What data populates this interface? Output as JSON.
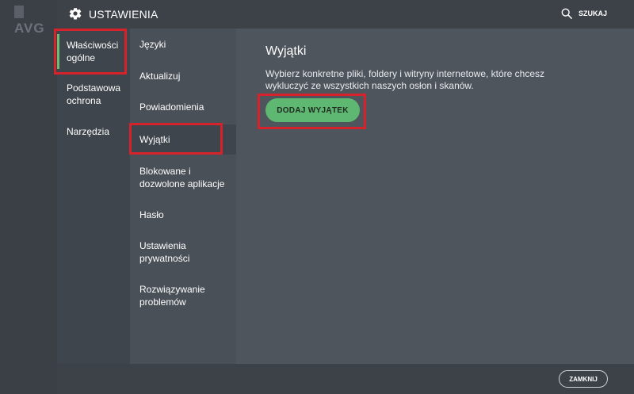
{
  "background_app": {
    "logo_text": "AVG"
  },
  "titlebar": {
    "title": "USTAWIENIA",
    "icon": "gear-icon",
    "search_label": "SZUKAJ",
    "search_icon": "search-icon"
  },
  "nav_primary": {
    "items": [
      {
        "label": "Właściwości ogólne",
        "active": true
      },
      {
        "label": "Podstawowa ochrona",
        "active": false
      },
      {
        "label": "Narzędzia",
        "active": false
      }
    ]
  },
  "nav_secondary": {
    "items": [
      {
        "label": "Języki",
        "active": false
      },
      {
        "label": "Aktualizuj",
        "active": false
      },
      {
        "label": "Powiadomienia",
        "active": false
      },
      {
        "label": "Wyjątki",
        "active": true
      },
      {
        "label": "Blokowane i dozwolone aplikacje",
        "active": false
      },
      {
        "label": "Hasło",
        "active": false
      },
      {
        "label": "Ustawienia prywatności",
        "active": false
      },
      {
        "label": "Rozwiązywanie problemów",
        "active": false
      }
    ]
  },
  "main": {
    "title": "Wyjątki",
    "description": "Wybierz konkretne pliki, foldery i witryny internetowe, które chcesz wykluczyć ze wszystkich naszych osłon i skanów.",
    "add_button_label": "DODAJ WYJĄTEK"
  },
  "footer": {
    "close_label": "ZAMKNIJ"
  },
  "colors": {
    "accent_green": "#5fb871",
    "highlight_red": "#d6232b",
    "panel_dark": "#3f454c",
    "panel_mid": "#4a5058",
    "panel_content": "#4f555d"
  }
}
